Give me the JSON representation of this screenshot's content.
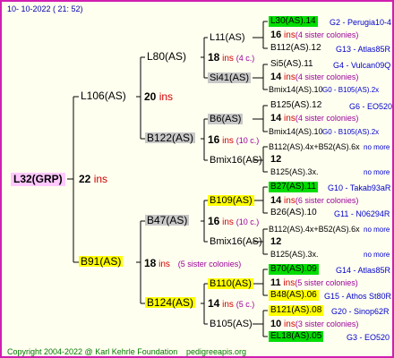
{
  "header": {
    "timestamp": "10-  10-2022  ( 21:  52)"
  },
  "footer": {
    "copyright": "Copyright 2004-2022 @ Karl Kehrle Foundation",
    "site": "pedigreeapis.org"
  },
  "root": {
    "label": "L32(GRP)",
    "ins": "22",
    "ins_word": "ins"
  },
  "gen1": [
    {
      "label": "L106(AS)",
      "ins": "20",
      "ins_word": "ins"
    },
    {
      "label": "B91(AS)",
      "ins": "18",
      "ins_word": "ins",
      "note": "(5 sister colonies)"
    }
  ],
  "gen2": [
    {
      "label": "L80(AS)",
      "ins": "18",
      "ins_word": "ins",
      "note": "(4 c.)"
    },
    {
      "label": "B122(AS)",
      "ins": "16",
      "ins_word": "ins",
      "note": "(10 c.)"
    },
    {
      "label": "B47(AS)",
      "ins": "16",
      "ins_word": "ins",
      "note": "(10 c.)"
    },
    {
      "label": "B124(AS)",
      "ins": "14",
      "ins_word": "ins",
      "note": "(5 c.)"
    }
  ],
  "gen3": [
    {
      "label": "L11(AS)"
    },
    {
      "label": "Si41(AS)"
    },
    {
      "label": "B6(AS)"
    },
    {
      "label": "Bmix16(AS)"
    },
    {
      "label": "B109(AS)"
    },
    {
      "label": "Bmix16(AS)"
    },
    {
      "label": "B110(AS)"
    },
    {
      "label": "B105(AS)"
    }
  ],
  "gen4": [
    {
      "top": "L30(AS).14",
      "top_info": "G2 - Perugia10-4",
      "ins": "16",
      "ins_word": "ins",
      "note": "(4 sister colonies)",
      "bottom": "B112(AS).12",
      "bottom_info": "G13 - Atlas85R"
    },
    {
      "top": "Si5(AS).11",
      "top_info": "G4 - Vulcan09Q",
      "ins": "14",
      "ins_word": "ins",
      "note": "(4 sister colonies)",
      "bottom": "Bmix14(AS).10",
      "bottom_info": "G0 - B105(AS).2x"
    },
    {
      "top": "B125(AS).12",
      "top_info": "G6 - EO520",
      "ins": "14",
      "ins_word": "ins",
      "note": "(4 sister colonies)",
      "bottom": "Bmix14(AS).10",
      "bottom_info": "G0 - B105(AS).2x"
    },
    {
      "top": "B112(AS).4x+B52(AS).6x",
      "top_info": "no more",
      "ins": "12",
      "ins_word": "",
      "note": "",
      "bottom": "B125(AS).3x.",
      "bottom_info": "no more"
    },
    {
      "top": "B27(AS).11",
      "top_info": "G10 - Takab93aR",
      "ins": "14",
      "ins_word": "ins",
      "note": "(6 sister colonies)",
      "bottom": "B26(AS).10",
      "bottom_info": "G11 - N06294R"
    },
    {
      "top": "B112(AS).4x+B52(AS).6x",
      "top_info": "no more",
      "ins": "12",
      "ins_word": "",
      "note": "",
      "bottom": "B125(AS).3x.",
      "bottom_info": "no more"
    },
    {
      "top": "B70(AS).09",
      "top_info": "G14 - Atlas85R",
      "ins": "11",
      "ins_word": "ins",
      "note": "(5 sister colonies)",
      "bottom": "B48(AS).06",
      "bottom_info": "G15 - Athos St80R"
    },
    {
      "top": "B121(AS).08",
      "top_info": "G20 - Sinop62R",
      "ins": "10",
      "ins_word": "ins",
      "note": "(3 sister colonies)",
      "bottom": "EL18(AS).05",
      "bottom_info": "G3 - EO520"
    }
  ],
  "colors": {
    "border": "#d01eb0",
    "background": "#fffff0",
    "root_bg": "#ffc8ff",
    "yellow": "#ffff00",
    "green": "#00dd00",
    "gray": "#c8c8c8",
    "ins_red": "#d00000",
    "info_blue": "#0000cc",
    "footer_green": "#007700"
  }
}
